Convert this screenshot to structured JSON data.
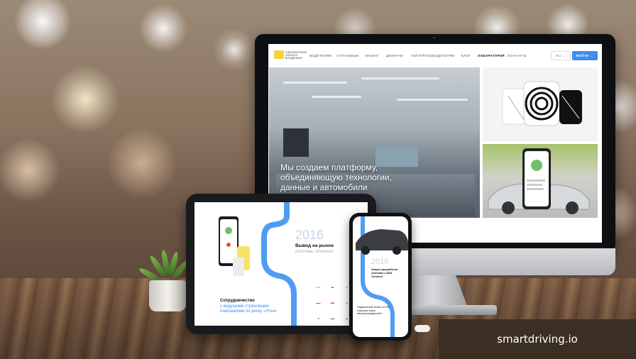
{
  "site": {
    "logo_text": "ЛАБОРАТОРИЯ УМНОГО ВОЖДЕНИЯ",
    "nav": [
      "ВОДИТЕЛЯМ",
      "СТРАХОВЫМ",
      "ЛИЗИНГ",
      "ДИЛЕРАМ",
      "АВТОПРОИЗВОДИТЕЛЯМ",
      "БЛОГ",
      "ЛАБОРАТОРИЯ",
      "КОНТАКТЫ"
    ],
    "active_nav": "ЛАБОРАТОРИЯ",
    "lang": "RU",
    "login_label": "ВОЙТИ →",
    "hero_title": "Мы создаем платформу, объединяющую технологии, данные и автомобили"
  },
  "tablet": {
    "year": "2016",
    "heading": "Вывод на рынок",
    "subheading": "системы Элемент",
    "coop_title": "Сотрудничество",
    "coop_text": "с ведущими страховыми компаниями по риску «Угон»"
  },
  "phone": {
    "year": "2018",
    "title": "Запуск разработки системы LADA Connect",
    "bottom_text": "Подключение более 10 000 клиентов через автопроизводителей"
  },
  "caption": "smartdriving.io",
  "colors": {
    "accent": "#3d8ef0",
    "logo_yellow": "#f7d33c"
  }
}
